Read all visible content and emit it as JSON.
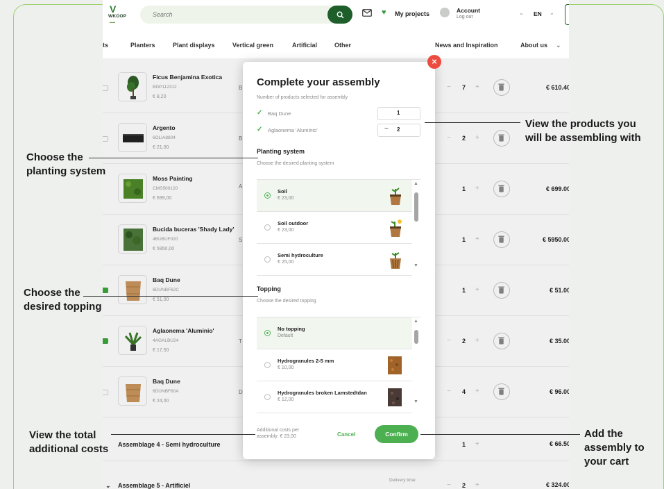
{
  "header": {
    "logo_text": "WKOOP",
    "search_placeholder": "Search",
    "my_projects": "My projects",
    "account": "Account",
    "logout": "Log out",
    "language": "EN"
  },
  "nav": {
    "partial_first": "ts",
    "items": [
      "Planters",
      "Plant displays",
      "Vertical green",
      "Artificial",
      "Other",
      "News and Inspiration",
      "About us"
    ]
  },
  "rows": [
    {
      "name": "Ficus Benjamina Exotica",
      "sku": "BDP112312",
      "price": "€ 8,20",
      "trunc": "B",
      "qty": "7",
      "total": "€ 610.40"
    },
    {
      "name": "Argento",
      "sku": "6OLIA8804",
      "price": "€ 21,00",
      "trunc": "B",
      "qty": "2",
      "total": ""
    },
    {
      "name": "Moss Painting",
      "sku": "CMS500120",
      "price": "€ 699,00",
      "trunc": "A",
      "qty": "1",
      "total": "€ 699.00"
    },
    {
      "name": "Bucida buceras 'Shady Lady'",
      "sku": "4BUBUF020",
      "price": "€ 5950,00",
      "trunc": "S",
      "qty": "1",
      "total": "€ 5950.00"
    },
    {
      "name": "Baq Dune",
      "sku": "6DUNBF62C",
      "price": "€ 51,00",
      "trunc": "",
      "qty": "1",
      "total": "€ 51.00"
    },
    {
      "name": "Aglaonema 'Aluminio'",
      "sku": "4AGALBU24",
      "price": "€ 17,50",
      "trunc": "T",
      "qty": "2",
      "total": "€ 35.00"
    },
    {
      "name": "Baq Dune",
      "sku": "6DUNBF60A",
      "price": "€ 24,00",
      "trunc": "D",
      "qty": "4",
      "total": "€ 96.00"
    }
  ],
  "assemblies": [
    {
      "title": "Assemblage 4 - Semi hydroculture",
      "qty": "1",
      "total": "€ 66.50",
      "delivery": ""
    },
    {
      "title": "Assemblage 5 - Artificiel",
      "qty": "2",
      "total": "€ 324.00",
      "delivery": "Delivery time:"
    }
  ],
  "modal": {
    "title": "Complete your assembly",
    "subtitle": "Number of products selected for assembly",
    "products": [
      {
        "name": "Baq Dune",
        "qty": "1",
        "minus": ""
      },
      {
        "name": "Aglaonema 'Aluminio'",
        "qty": "2",
        "minus": "−"
      }
    ],
    "planting": {
      "heading": "Planting system",
      "subheading": "Choose the desired planting system",
      "options": [
        {
          "name": "Soil",
          "price": "€ 23,00",
          "selected": true
        },
        {
          "name": "Soil outdoor",
          "price": "€ 23,00",
          "selected": false
        },
        {
          "name": "Semi hydroculture",
          "price": "€ 25,00",
          "selected": false
        }
      ]
    },
    "topping": {
      "heading": "Topping",
      "subheading": "Choose the desired topping",
      "options": [
        {
          "name": "No topping",
          "price": "Default",
          "selected": true
        },
        {
          "name": "Hydrogranules 2-5 mm",
          "price": "€ 10,00",
          "selected": false
        },
        {
          "name": "Hydrogranules broken Lamstedtdan",
          "price": "€ 12,00",
          "selected": false
        }
      ]
    },
    "additional_costs": "Additional costs per assembly: € 23,00",
    "cancel": "Cancel",
    "confirm": "Confirm",
    "close_icon": "close-icon"
  },
  "annotations": {
    "planting": [
      "Choose the",
      "planting system"
    ],
    "topping": [
      "Choose the",
      "desired topping"
    ],
    "products": [
      "View the products you",
      "will be assembling with"
    ],
    "costs": [
      "View the total",
      "additional costs"
    ],
    "cart": [
      "Add the",
      "assembly to",
      "your cart"
    ]
  },
  "colors": {
    "accent": "#4caf50",
    "brand_dark": "#1d5e2a",
    "close": "#ec4b3f",
    "frame": "#9fcf6d"
  }
}
